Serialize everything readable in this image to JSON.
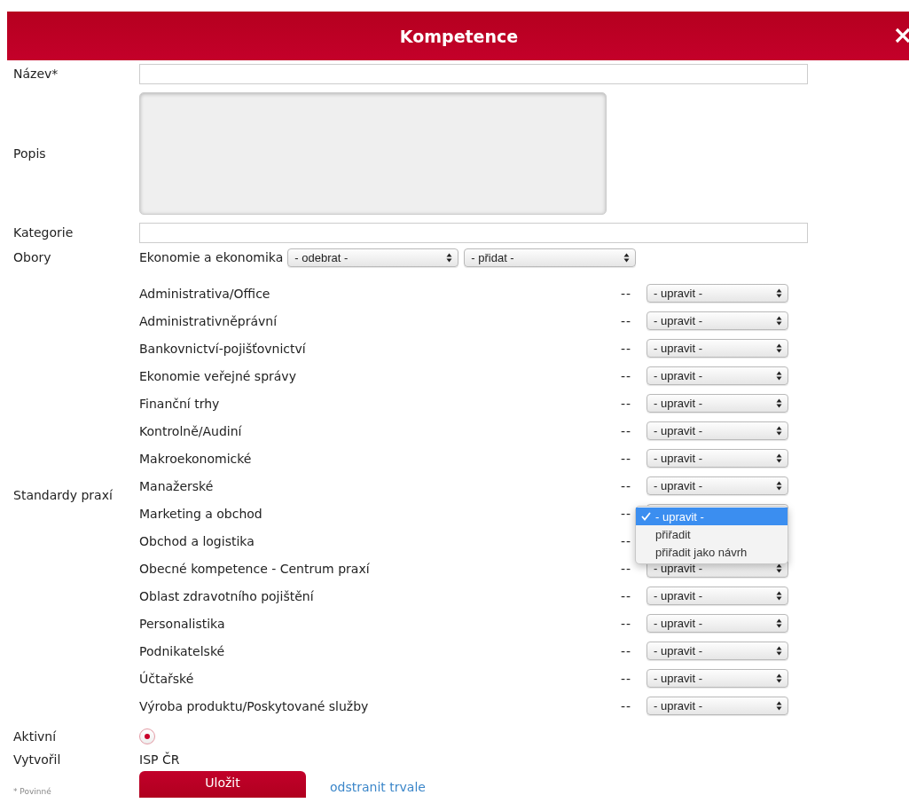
{
  "dialog": {
    "title": "Kompetence"
  },
  "name_field": {
    "label": "Název*"
  },
  "description_field": {
    "label": "Popis"
  },
  "category_field": {
    "label": "Kategorie"
  },
  "obory": {
    "label": "Obory",
    "value": "Ekonomie a ekonomika",
    "selects": [
      "- odebrat -",
      "- přidat -"
    ]
  },
  "standards": {
    "label": "Standardy praxí",
    "rows": [
      {
        "name": "Administrativa/Office",
        "dash": "--",
        "select": "- upravit -"
      },
      {
        "name": "Administrativněprávní",
        "dash": "--",
        "select": "- upravit -"
      },
      {
        "name": "Bankovnictví-pojišťovnictví",
        "dash": "--",
        "select": "- upravit -"
      },
      {
        "name": "Ekonomie veřejné správy",
        "dash": "--",
        "select": "- upravit -"
      },
      {
        "name": "Finanční trhy",
        "dash": "--",
        "select": "- upravit -"
      },
      {
        "name": "Kontrolně/Audiní",
        "dash": "--",
        "select": "- upravit -"
      },
      {
        "name": "Makroekonomické",
        "dash": "--",
        "select": "- upravit -"
      },
      {
        "name": "Manažerské",
        "dash": "--",
        "select": "- upravit -"
      },
      {
        "name": "Marketing a obchod",
        "dash": "--",
        "menu": {
          "options": [
            {
              "label": "- upravit -",
              "selected": true
            },
            {
              "label": "přiřadit",
              "selected": false
            },
            {
              "label": "přiřadit jako návrh",
              "selected": false
            }
          ]
        }
      },
      {
        "name": "Obchod a logistika",
        "dash": "--"
      },
      {
        "name": "Obecné kompetence - Centrum praxí",
        "dash": "--",
        "select": "- upravit -"
      },
      {
        "name": "Oblast zdravotního pojištění",
        "dash": "--",
        "select": "- upravit -"
      },
      {
        "name": "Personalistika",
        "dash": "--",
        "select": "- upravit -"
      },
      {
        "name": "Podnikatelské",
        "dash": "--",
        "select": "- upravit -"
      },
      {
        "name": "Účtařské",
        "dash": "--",
        "select": "- upravit -"
      },
      {
        "name": "Výroba produktu/Poskytované služby",
        "dash": "--",
        "select": "- upravit -"
      }
    ]
  },
  "active": {
    "label": "Aktivní",
    "checked": true
  },
  "created_by": {
    "label": "Vytvořil",
    "value": "ISP ČR"
  },
  "footer": {
    "required_note": "* Povinné",
    "save_button": "Uložit",
    "delete_link": "odstranit trvale"
  }
}
